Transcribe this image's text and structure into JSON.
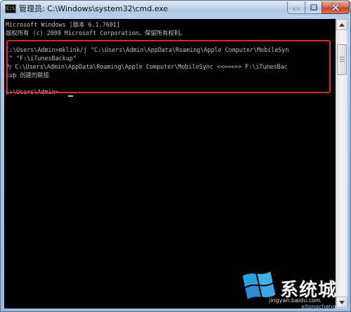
{
  "window": {
    "title": "管理员: C:\\Windows\\system32\\cmd.exe",
    "icon": "cmd-app-icon"
  },
  "controls": {
    "minimize": "minimize-icon",
    "maximize": "maximize-icon",
    "close": "close-icon"
  },
  "console": {
    "lines": [
      "Microsoft Windows [版本 6.1.7601]",
      "版权所有 (c) 2009 Microsoft Corporation。保留所有权利。",
      "",
      "C:\\Users\\Admin>mklink/j \"C:\\Users\\Admin\\AppData\\Roaming\\Apple Computer\\MobileSyn",
      "c\" \"F:\\iTunesBackup\"",
      "为 C:\\Users\\Admin\\AppData\\Roaming\\Apple Computer\\MobileSync <<===>> F:\\iTunesBac",
      "kup 创建的联接",
      "",
      "C:\\Users\\Admin>"
    ],
    "text_color": "#c0c0c0",
    "background": "#000000",
    "highlight_color": "#e1232f"
  },
  "watermark": {
    "brand": "系统城",
    "site_a": "jingyan.baidu.com",
    "site_b": "xitongcheng.com",
    "logo": "windows-logo-icon"
  }
}
